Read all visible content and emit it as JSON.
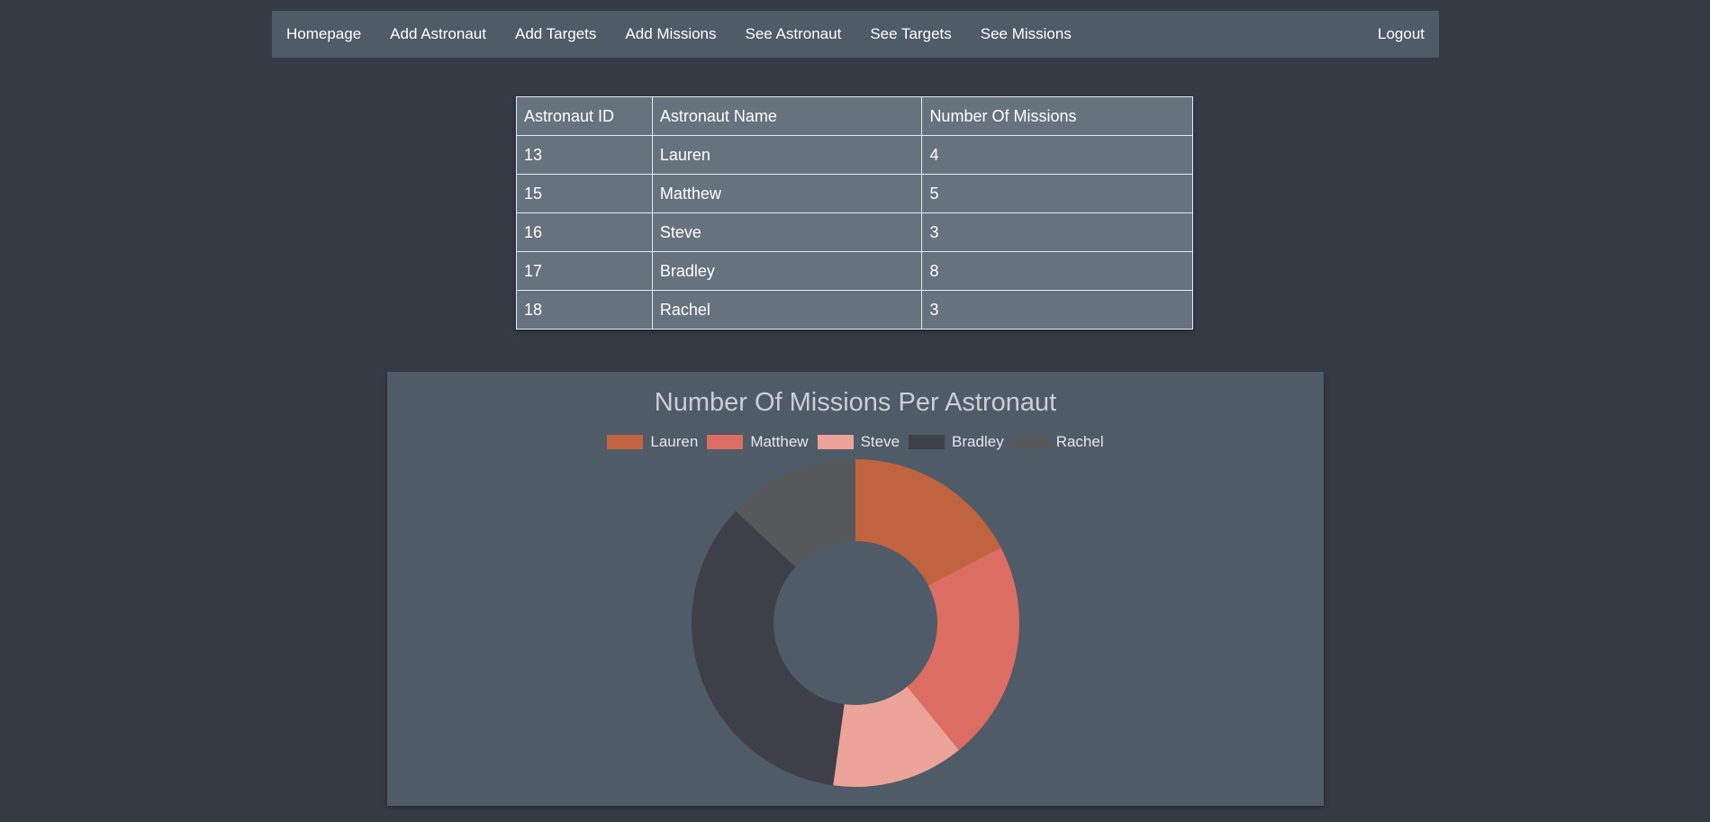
{
  "nav": {
    "links": [
      "Homepage",
      "Add Astronaut",
      "Add Targets",
      "Add Missions",
      "See Astronaut",
      "See Targets",
      "See Missions"
    ],
    "logout": "Logout"
  },
  "table": {
    "headers": [
      "Astronaut ID",
      "Astronaut Name",
      "Number Of Missions"
    ],
    "rows": [
      [
        "13",
        "Lauren",
        "4"
      ],
      [
        "15",
        "Matthew",
        "5"
      ],
      [
        "16",
        "Steve",
        "3"
      ],
      [
        "17",
        "Bradley",
        "8"
      ],
      [
        "18",
        "Rachel",
        "3"
      ]
    ]
  },
  "chart_data": {
    "type": "pie",
    "variant": "doughnut",
    "title": "Number Of Missions Per Astronaut",
    "legend_position": "top",
    "categories": [
      "Lauren",
      "Matthew",
      "Steve",
      "Bradley",
      "Rachel"
    ],
    "values": [
      4,
      5,
      3,
      8,
      3
    ],
    "colors": [
      "#c0643f",
      "#dc6d62",
      "#eba39a",
      "#3e3f48",
      "#575859"
    ]
  },
  "colors": {
    "page_background": "#343b45",
    "navbar_background": "#4f5b67",
    "table_background": "#66737e",
    "chart_panel_background": "#4f5b67"
  }
}
